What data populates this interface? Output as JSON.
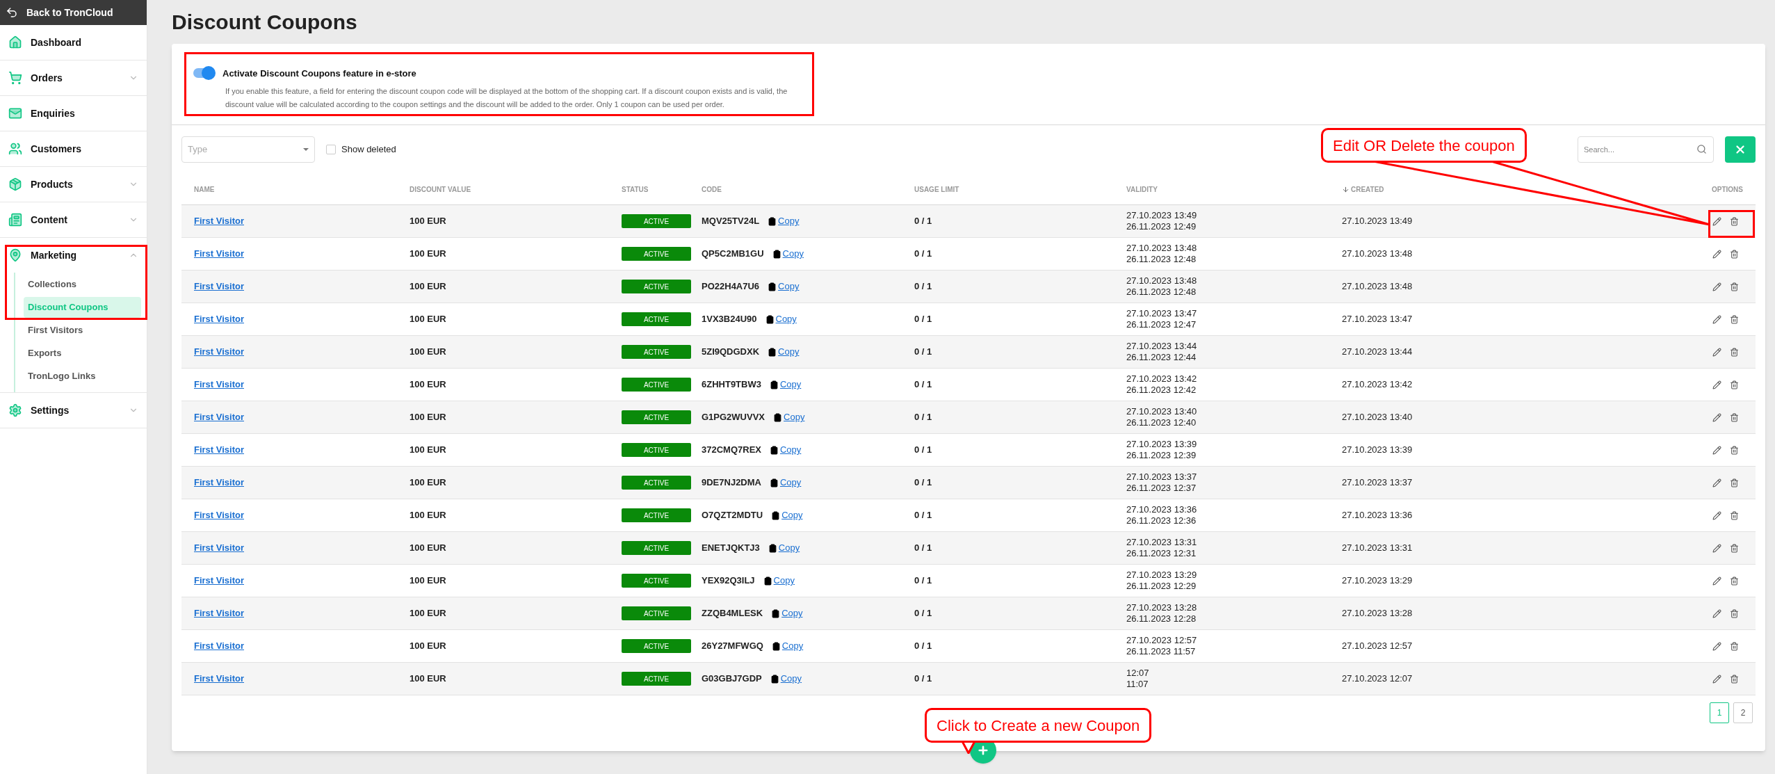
{
  "sidebar": {
    "back_link": "Back to TronCloud",
    "items": [
      {
        "label": "Dashboard",
        "expandable": false
      },
      {
        "label": "Orders",
        "expandable": true,
        "expanded": false
      },
      {
        "label": "Enquiries",
        "expandable": false
      },
      {
        "label": "Customers",
        "expandable": false
      },
      {
        "label": "Products",
        "expandable": true,
        "expanded": false
      },
      {
        "label": "Content",
        "expandable": true,
        "expanded": false
      },
      {
        "label": "Marketing",
        "expandable": true,
        "expanded": true,
        "children": [
          {
            "label": "Collections",
            "selected": false
          },
          {
            "label": "Discount Coupons",
            "selected": true
          },
          {
            "label": "First Visitors",
            "selected": false
          },
          {
            "label": "Exports",
            "selected": false
          },
          {
            "label": "TronLogo Links",
            "selected": false
          }
        ]
      },
      {
        "label": "Settings",
        "expandable": true,
        "expanded": false
      }
    ]
  },
  "page_title": "Discount Coupons",
  "feature": {
    "on": true,
    "title": "Activate Discount Coupons feature in e-store",
    "description": "If you enable this feature, a field for entering the discount coupon code will be displayed at the bottom of the shopping cart. If a discount coupon exists and is valid, the discount value will be calculated according to the coupon settings and the discount will be added to the order. Only 1 coupon can be used per order."
  },
  "filters": {
    "type": {
      "placeholder": "Type"
    },
    "show_deleted": {
      "label": "Show deleted",
      "checked": false
    },
    "search": {
      "placeholder": "Search..."
    }
  },
  "table": {
    "columns": [
      {
        "label": "NAME",
        "sorted": false
      },
      {
        "label": "DISCOUNT VALUE",
        "sorted": false
      },
      {
        "label": "STATUS",
        "sorted": false
      },
      {
        "label": "CODE",
        "sorted": false
      },
      {
        "label": "USAGE LIMIT",
        "sorted": false
      },
      {
        "label": "VALIDITY",
        "sorted": false
      },
      {
        "label": "CREATED",
        "sorted": true
      },
      {
        "label": "OPTIONS",
        "sorted": false
      }
    ],
    "rows": [
      {
        "name": "First Visitor",
        "discount": "100 EUR",
        "status": "ACTIVE",
        "code": "MQV25TV24L",
        "copy": "Copy",
        "usage": "0 / 1",
        "valid_from": "27.10.2023 13:49",
        "valid_to": "26.11.2023 12:49",
        "created": "27.10.2023 13:49"
      },
      {
        "name": "First Visitor",
        "discount": "100 EUR",
        "status": "ACTIVE",
        "code": "QP5C2MB1GU",
        "copy": "Copy",
        "usage": "0 / 1",
        "valid_from": "27.10.2023 13:48",
        "valid_to": "26.11.2023 12:48",
        "created": "27.10.2023 13:48"
      },
      {
        "name": "First Visitor",
        "discount": "100 EUR",
        "status": "ACTIVE",
        "code": "PO22H4A7U6",
        "copy": "Copy",
        "usage": "0 / 1",
        "valid_from": "27.10.2023 13:48",
        "valid_to": "26.11.2023 12:48",
        "created": "27.10.2023 13:48"
      },
      {
        "name": "First Visitor",
        "discount": "100 EUR",
        "status": "ACTIVE",
        "code": "1VX3B24U90",
        "copy": "Copy",
        "usage": "0 / 1",
        "valid_from": "27.10.2023 13:47",
        "valid_to": "26.11.2023 12:47",
        "created": "27.10.2023 13:47"
      },
      {
        "name": "First Visitor",
        "discount": "100 EUR",
        "status": "ACTIVE",
        "code": "5ZI9QDGDXK",
        "copy": "Copy",
        "usage": "0 / 1",
        "valid_from": "27.10.2023 13:44",
        "valid_to": "26.11.2023 12:44",
        "created": "27.10.2023 13:44"
      },
      {
        "name": "First Visitor",
        "discount": "100 EUR",
        "status": "ACTIVE",
        "code": "6ZHHT9TBW3",
        "copy": "Copy",
        "usage": "0 / 1",
        "valid_from": "27.10.2023 13:42",
        "valid_to": "26.11.2023 12:42",
        "created": "27.10.2023 13:42"
      },
      {
        "name": "First Visitor",
        "discount": "100 EUR",
        "status": "ACTIVE",
        "code": "G1PG2WUVVX",
        "copy": "Copy",
        "usage": "0 / 1",
        "valid_from": "27.10.2023 13:40",
        "valid_to": "26.11.2023 12:40",
        "created": "27.10.2023 13:40"
      },
      {
        "name": "First Visitor",
        "discount": "100 EUR",
        "status": "ACTIVE",
        "code": "372CMQ7REX",
        "copy": "Copy",
        "usage": "0 / 1",
        "valid_from": "27.10.2023 13:39",
        "valid_to": "26.11.2023 12:39",
        "created": "27.10.2023 13:39"
      },
      {
        "name": "First Visitor",
        "discount": "100 EUR",
        "status": "ACTIVE",
        "code": "9DE7NJ2DMA",
        "copy": "Copy",
        "usage": "0 / 1",
        "valid_from": "27.10.2023 13:37",
        "valid_to": "26.11.2023 12:37",
        "created": "27.10.2023 13:37"
      },
      {
        "name": "First Visitor",
        "discount": "100 EUR",
        "status": "ACTIVE",
        "code": "O7QZT2MDTU",
        "copy": "Copy",
        "usage": "0 / 1",
        "valid_from": "27.10.2023 13:36",
        "valid_to": "26.11.2023 12:36",
        "created": "27.10.2023 13:36"
      },
      {
        "name": "First Visitor",
        "discount": "100 EUR",
        "status": "ACTIVE",
        "code": "ENETJQKTJ3",
        "copy": "Copy",
        "usage": "0 / 1",
        "valid_from": "27.10.2023 13:31",
        "valid_to": "26.11.2023 12:31",
        "created": "27.10.2023 13:31"
      },
      {
        "name": "First Visitor",
        "discount": "100 EUR",
        "status": "ACTIVE",
        "code": "YEX92Q3ILJ",
        "copy": "Copy",
        "usage": "0 / 1",
        "valid_from": "27.10.2023 13:29",
        "valid_to": "26.11.2023 12:29",
        "created": "27.10.2023 13:29"
      },
      {
        "name": "First Visitor",
        "discount": "100 EUR",
        "status": "ACTIVE",
        "code": "ZZQB4MLESK",
        "copy": "Copy",
        "usage": "0 / 1",
        "valid_from": "27.10.2023 13:28",
        "valid_to": "26.11.2023 12:28",
        "created": "27.10.2023 13:28"
      },
      {
        "name": "First Visitor",
        "discount": "100 EUR",
        "status": "ACTIVE",
        "code": "26Y27MFWGQ",
        "copy": "Copy",
        "usage": "0 / 1",
        "valid_from": "27.10.2023 12:57",
        "valid_to": "26.11.2023 11:57",
        "created": "27.10.2023 12:57"
      },
      {
        "name": "First Visitor",
        "discount": "100 EUR",
        "status": "ACTIVE",
        "code": "G03GBJ7GDP",
        "copy": "Copy",
        "usage": "0 / 1",
        "valid_from": "12:07",
        "valid_to": "11:07",
        "created": "27.10.2023 12:07"
      }
    ]
  },
  "pagination": [
    {
      "label": "1",
      "selected": true
    },
    {
      "label": "2",
      "selected": false
    }
  ],
  "callouts": [
    {
      "text": "Edit OR Delete the coupon"
    },
    {
      "text": "Click to Create a new Coupon"
    }
  ]
}
